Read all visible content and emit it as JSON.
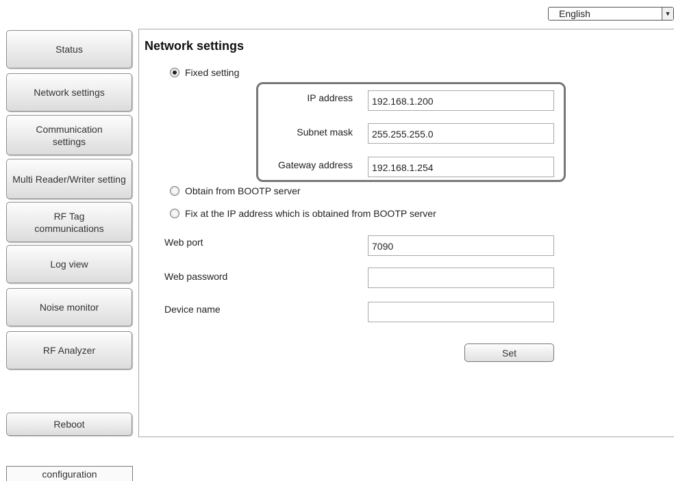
{
  "language": {
    "selected": "English"
  },
  "sidebar": {
    "items": [
      {
        "label": "Status"
      },
      {
        "label": "Network settings"
      },
      {
        "label": "Communication settings"
      },
      {
        "label": "Multi Reader/Writer setting"
      },
      {
        "label": "RF Tag communications"
      },
      {
        "label": "Log view"
      },
      {
        "label": "Noise monitor"
      },
      {
        "label": "RF Analyzer"
      }
    ],
    "reboot_label": "Reboot",
    "configuration_label": "configuration"
  },
  "main": {
    "title": "Network settings",
    "options": {
      "fixed": "Fixed setting",
      "bootp": "Obtain from BOOTP server",
      "fix_bootp": "Fix at the IP address which is obtained from BOOTP server",
      "selected": "fixed"
    },
    "fixed_fields": {
      "ip_label": "IP address",
      "ip_value": "192.168.1.200",
      "subnet_label": "Subnet mask",
      "subnet_value": "255.255.255.0",
      "gateway_label": "Gateway address",
      "gateway_value": "192.168.1.254"
    },
    "web_port_label": "Web port",
    "web_port_value": "7090",
    "web_password_label": "Web password",
    "web_password_value": "",
    "device_name_label": "Device name",
    "device_name_value": "",
    "set_label": "Set"
  }
}
